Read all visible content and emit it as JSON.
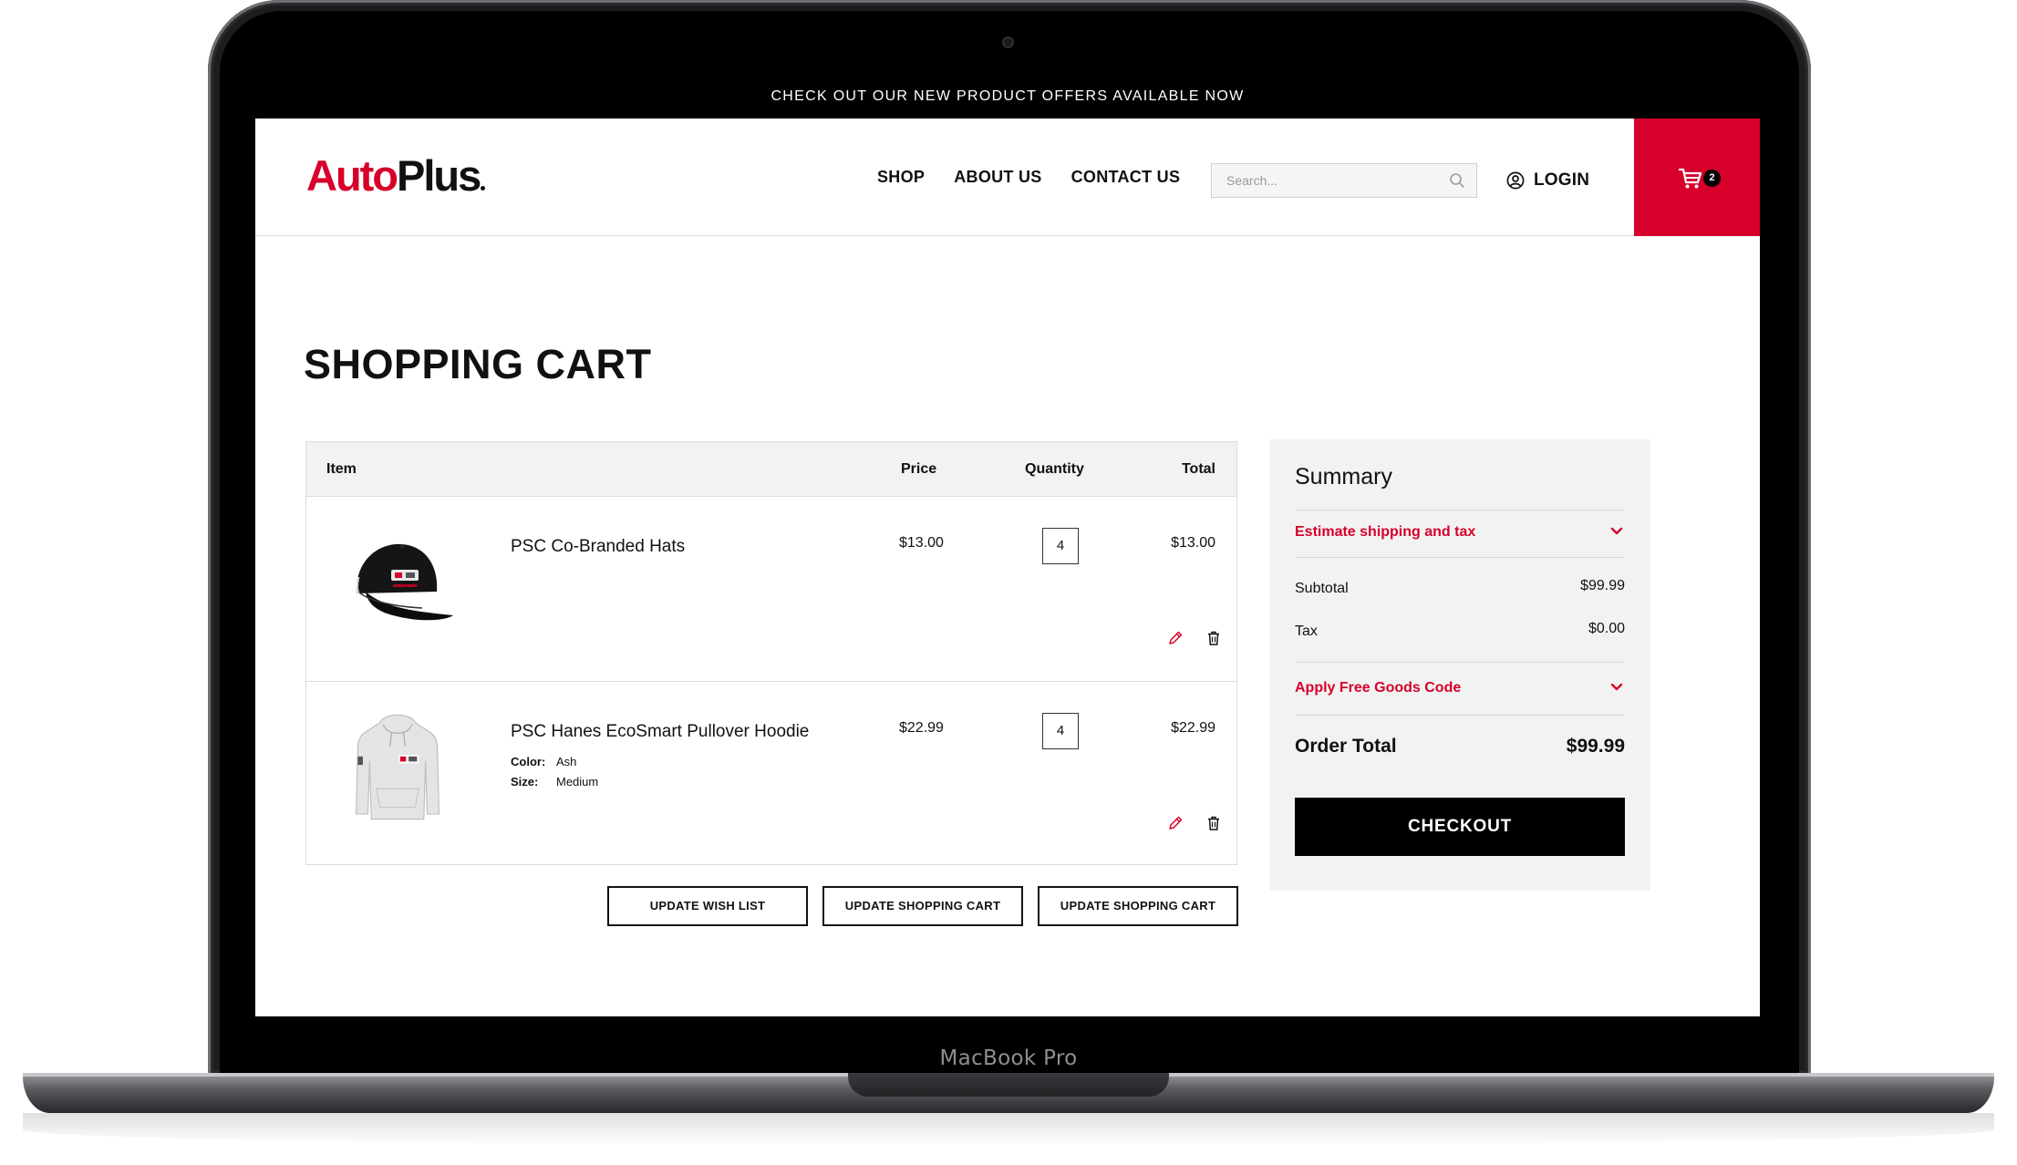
{
  "device": {
    "label": "MacBook Pro"
  },
  "promo": {
    "text": "CHECK OUT OUR NEW PRODUCT OFFERS AVAILABLE NOW"
  },
  "header": {
    "logo_part1": "Auto",
    "logo_part2": "Plus",
    "nav": [
      {
        "label": "SHOP"
      },
      {
        "label": "ABOUT US"
      },
      {
        "label": "CONTACT US"
      }
    ],
    "search_placeholder": "Search...",
    "login_label": "LOGIN",
    "cart_count": "2",
    "accent_color": "#d6002a"
  },
  "page": {
    "title": "SHOPPING CART"
  },
  "cart": {
    "columns": {
      "item": "Item",
      "price": "Price",
      "quantity": "Quantity",
      "total": "Total"
    },
    "items": [
      {
        "name": "PSC Co-Branded Hats",
        "price": "$13.00",
        "quantity": "4",
        "total": "$13.00",
        "image_icon": "black-cap-image"
      },
      {
        "name": "PSC Hanes EcoSmart Pullover Hoodie",
        "price": "$22.99",
        "quantity": "4",
        "total": "$22.99",
        "image_icon": "grey-hoodie-image",
        "options": [
          {
            "label": "Color:",
            "value": "Ash"
          },
          {
            "label": "Size:",
            "value": "Medium"
          }
        ]
      }
    ],
    "buttons": {
      "wishlist": "UPDATE WISH LIST",
      "update1": "UPDATE SHOPPING CART",
      "update2": "UPDATE SHOPPING CART"
    }
  },
  "summary": {
    "title": "Summary",
    "estimate_label": "Estimate shipping and tax",
    "subtotal_label": "Subtotal",
    "subtotal_value": "$99.99",
    "tax_label": "Tax",
    "tax_value": "$0.00",
    "free_goods_label": "Apply Free Goods Code",
    "order_total_label": "Order Total",
    "order_total_value": "$99.99",
    "checkout_label": "CHECKOUT"
  }
}
